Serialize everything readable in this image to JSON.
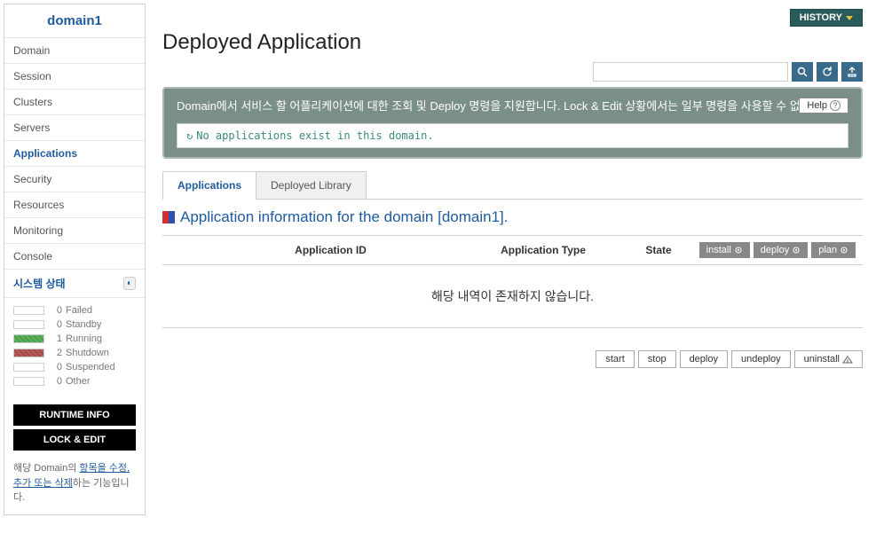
{
  "sidebar": {
    "title": "domain1",
    "items": [
      {
        "label": "Domain"
      },
      {
        "label": "Session"
      },
      {
        "label": "Clusters"
      },
      {
        "label": "Servers"
      },
      {
        "label": "Applications",
        "active": true
      },
      {
        "label": "Security"
      },
      {
        "label": "Resources"
      },
      {
        "label": "Monitoring"
      },
      {
        "label": "Console"
      }
    ],
    "system_status_label": "시스템 상태",
    "statuses": [
      {
        "count": "0",
        "label": "Failed"
      },
      {
        "count": "0",
        "label": "Standby"
      },
      {
        "count": "1",
        "label": "Running"
      },
      {
        "count": "2",
        "label": "Shutdown"
      },
      {
        "count": "0",
        "label": "Suspended"
      },
      {
        "count": "0",
        "label": "Other"
      }
    ],
    "runtime_info_btn": "RUNTIME INFO",
    "lock_edit_btn": "LOCK & EDIT",
    "desc_prefix": "해당 Domain의 ",
    "desc_link": "항목을 수정, 추가 또는 삭제",
    "desc_suffix": "하는 기능입니다."
  },
  "header": {
    "history_btn": "HISTORY",
    "page_title": "Deployed Application"
  },
  "banner": {
    "text": "Domain에서 서비스 할 어플리케이션에 대한 조회 및 Deploy 명령을 지원합니다. Lock & Edit 상황에서는 일부 명령을 사용할 수 없습니다.",
    "help_btn": "Help",
    "message": "No applications exist in this domain."
  },
  "tabs": {
    "applications": "Applications",
    "deployed_library": "Deployed Library"
  },
  "section": {
    "title": "Application information for the domain [domain1]."
  },
  "table": {
    "headers": {
      "app_id": "Application ID",
      "app_type": "Application Type",
      "state": "State"
    },
    "actions": {
      "install": "install",
      "deploy": "deploy",
      "plan": "plan"
    },
    "empty": "해당 내역이 존재하지 않습니다."
  },
  "bottom_actions": {
    "start": "start",
    "stop": "stop",
    "deploy": "deploy",
    "undeploy": "undeploy",
    "uninstall": "uninstall"
  }
}
